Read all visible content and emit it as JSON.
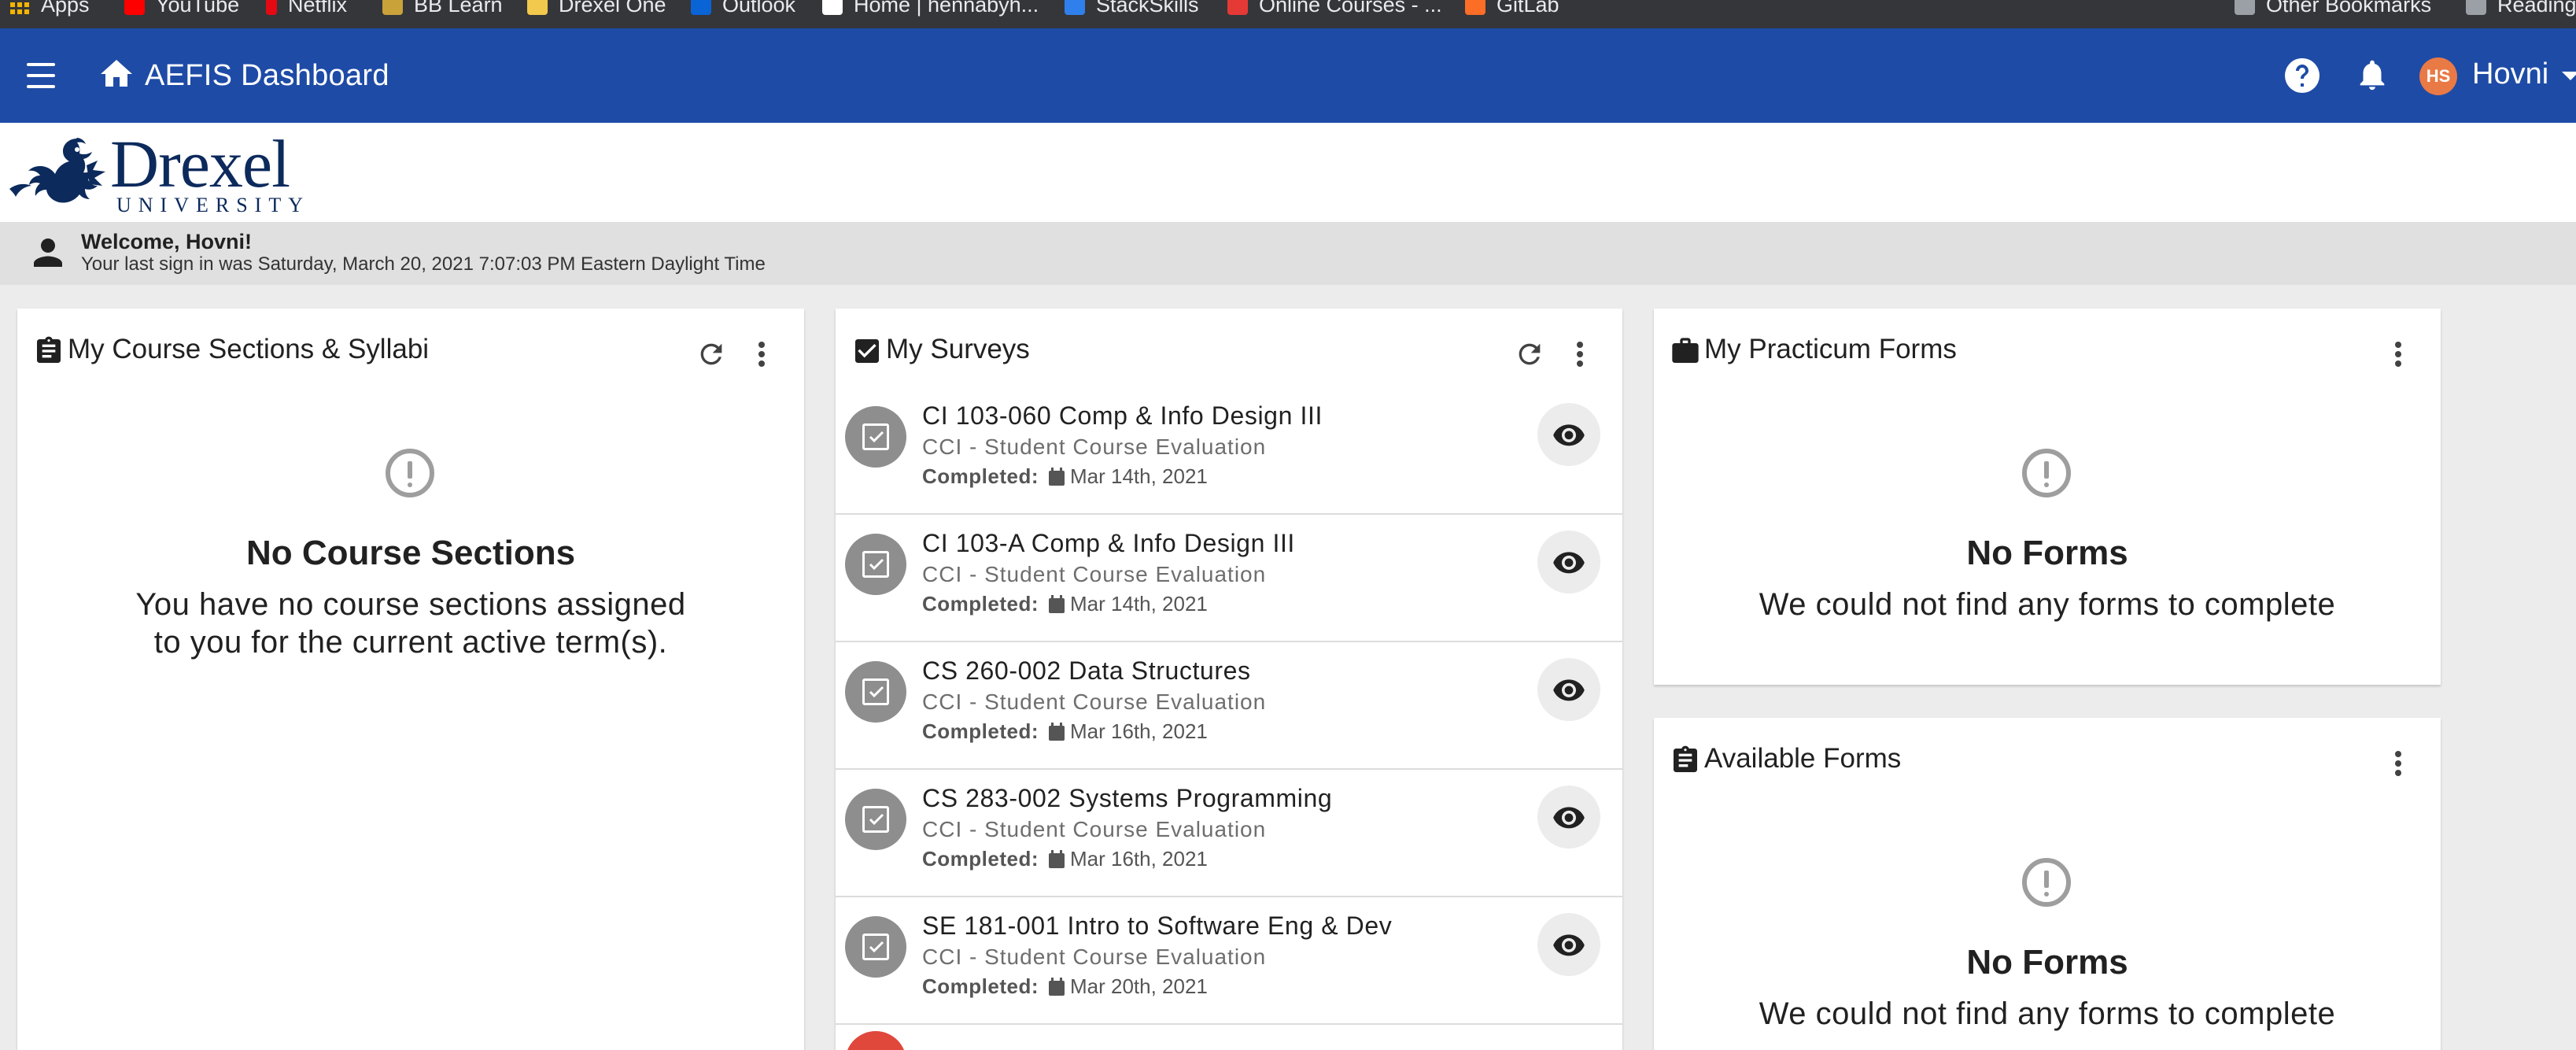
{
  "bookmarks": [
    {
      "label": "Apps",
      "color": "#f4b400",
      "icon": "apps-grid-icon"
    },
    {
      "label": "YouTube",
      "color": "#ff0000",
      "icon": "youtube-icon"
    },
    {
      "label": "Netflix",
      "color": "#e50914",
      "icon": "netflix-icon"
    },
    {
      "label": "BB Learn",
      "color": "#c9a23a",
      "icon": "bblearn-icon"
    },
    {
      "label": "Drexel One",
      "color": "#f2c94c",
      "icon": "drexel-one-icon"
    },
    {
      "label": "Outlook",
      "color": "#0a64d6",
      "icon": "outlook-icon"
    },
    {
      "label": "Home | hennabyh...",
      "color": "#ffffff",
      "icon": "page-icon"
    },
    {
      "label": "StackSkills",
      "color": "#2f80ed",
      "icon": "stackskills-icon"
    },
    {
      "label": "Online Courses - ...",
      "color": "#e53935",
      "icon": "udemy-icon"
    },
    {
      "label": "GitLab",
      "color": "#fc6d26",
      "icon": "gitlab-icon"
    },
    {
      "label": "Other Bookmarks",
      "color": "#9aa0a6",
      "icon": "folder-icon"
    },
    {
      "label": "Reading",
      "color": "#9aa0a6",
      "icon": "reading-list-icon"
    }
  ],
  "appbar": {
    "title": "AEFIS Dashboard",
    "avatar_initials": "HS",
    "username": "Hovni",
    "color": "#1e4ba6"
  },
  "logo": {
    "word": "Drexel",
    "sub": "UNIVERSITY"
  },
  "welcome": {
    "greeting": "Welcome, Hovni!",
    "last_sign_in": "Your last sign in was Saturday, March 20, 2021 7:07:03 PM Eastern Daylight Time"
  },
  "courses_card": {
    "title": "My Course Sections & Syllabi",
    "empty_title": "No Course Sections",
    "empty_line1": "You have no course sections assigned",
    "empty_line2": "to you for the current active term(s)."
  },
  "surveys_card": {
    "title": "My Surveys",
    "completed_label": "Completed:",
    "items": [
      {
        "title": "CI 103-060 Comp & Info Design III",
        "subtitle": "CCI - Student Course Evaluation",
        "date": "Mar 14th, 2021"
      },
      {
        "title": "CI 103-A Comp & Info Design III",
        "subtitle": "CCI - Student Course Evaluation",
        "date": "Mar 14th, 2021"
      },
      {
        "title": "CS 260-002 Data Structures",
        "subtitle": "CCI - Student Course Evaluation",
        "date": "Mar 16th, 2021"
      },
      {
        "title": "CS 283-002 Systems Programming",
        "subtitle": "CCI - Student Course Evaluation",
        "date": "Mar 16th, 2021"
      },
      {
        "title": "SE 181-001 Intro to Software Eng & Dev",
        "subtitle": "CCI - Student Course Evaluation",
        "date": "Mar 20th, 2021"
      }
    ]
  },
  "practicum_card": {
    "title": "My Practicum Forms",
    "empty_title": "No Forms",
    "empty_text": "We could not find any forms to complete"
  },
  "available_card": {
    "title": "Available Forms",
    "empty_title": "No Forms",
    "empty_text": "We could not find any forms to complete"
  }
}
